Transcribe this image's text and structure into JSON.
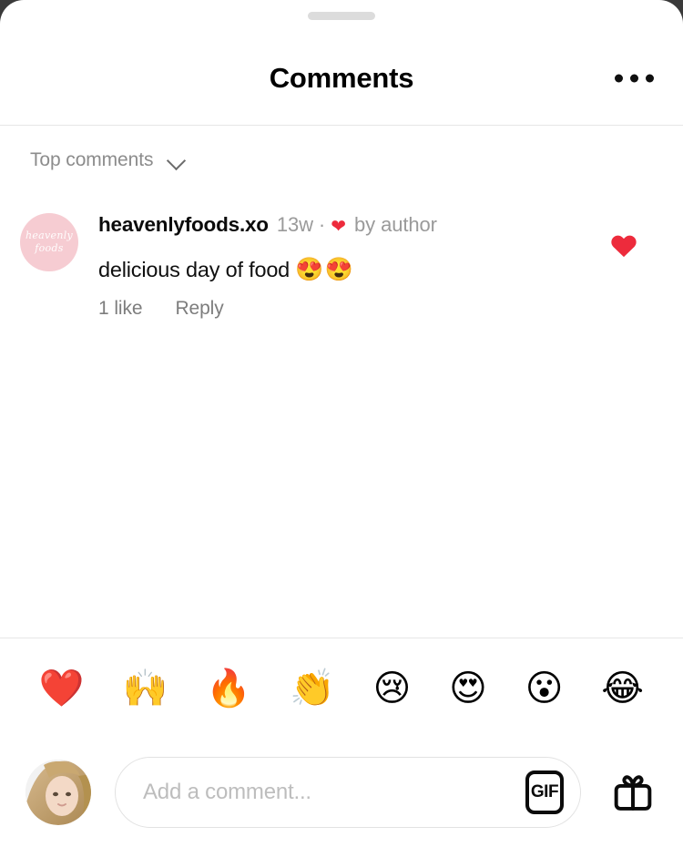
{
  "sheet": {
    "drag_handle": "drag-handle"
  },
  "header": {
    "title": "Comments",
    "more_icon": "more-horizontal-icon"
  },
  "sort": {
    "label": "Top comments",
    "chevron_icon": "chevron-down-icon"
  },
  "comments": [
    {
      "username": "heavenlyfoods.xo",
      "time": "13w",
      "separator": "·",
      "author_heart_icon": "heart-filled-icon",
      "author_badge": "by author",
      "text": "delicious day of food",
      "text_emoji": "😍😍",
      "likes": "1 like",
      "reply": "Reply",
      "liked": true,
      "like_icon": "heart-filled-icon",
      "avatar": {
        "kind": "pink-wordmark",
        "line1": "heavenly",
        "line2": "foods",
        "bg": "#f6ccd2"
      }
    }
  ],
  "quick_emojis": [
    {
      "char": "❤️",
      "name": "red-heart-emoji"
    },
    {
      "char": "🙌",
      "name": "raising-hands-emoji"
    },
    {
      "char": "🔥",
      "name": "fire-emoji"
    },
    {
      "char": "👏",
      "name": "clapping-hands-emoji"
    },
    {
      "char": "😢",
      "name": "crying-face-emoji"
    },
    {
      "char": "😍",
      "name": "heart-eyes-emoji"
    },
    {
      "char": "😮",
      "name": "open-mouth-emoji"
    },
    {
      "char": "😂",
      "name": "tears-of-joy-emoji"
    }
  ],
  "composer": {
    "placeholder": "Add a comment...",
    "value": "",
    "gif_label": "GIF",
    "gift_icon": "gift-icon",
    "avatar_alt": "user-avatar"
  },
  "colors": {
    "accent_red": "#ed2b3c",
    "muted_text": "#8c8c8c",
    "divider": "#e6e6e6",
    "backdrop": "#3a3a3a"
  }
}
